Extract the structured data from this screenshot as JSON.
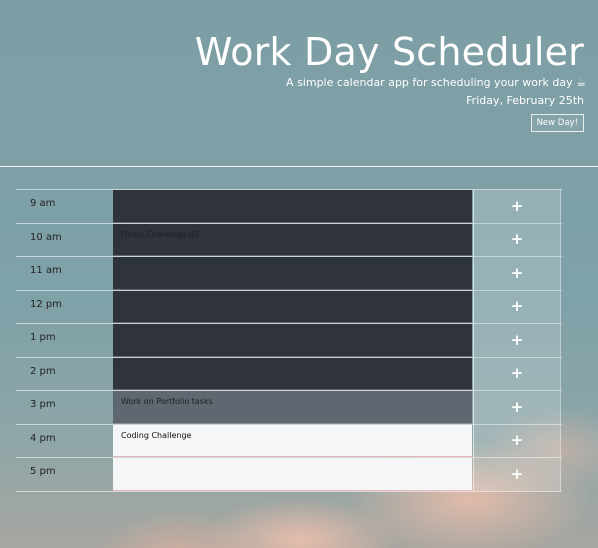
{
  "header": {
    "title": "Work Day Scheduler",
    "tagline": "A simple calendar app for scheduling your work day ☕",
    "date": "Friday, February 25th",
    "new_day_label": "New Day!"
  },
  "rows": [
    {
      "hour": "9 am",
      "task": "",
      "state": "past"
    },
    {
      "hour": "10 am",
      "task": "Finish Challenge 05",
      "state": "past"
    },
    {
      "hour": "11 am",
      "task": "",
      "state": "past"
    },
    {
      "hour": "12 pm",
      "task": "",
      "state": "past"
    },
    {
      "hour": "1 pm",
      "task": "",
      "state": "past"
    },
    {
      "hour": "2 pm",
      "task": "",
      "state": "past"
    },
    {
      "hour": "3 pm",
      "task": "Work on Portfolio tasks",
      "state": "present"
    },
    {
      "hour": "4 pm",
      "task": "Coding Challenge",
      "state": "future"
    },
    {
      "hour": "5 pm",
      "task": "",
      "state": "future"
    }
  ],
  "save_icon": "plus-icon",
  "colors": {
    "past": "#2f333b",
    "present": "#5f6870",
    "future": "#f4f6f8"
  }
}
